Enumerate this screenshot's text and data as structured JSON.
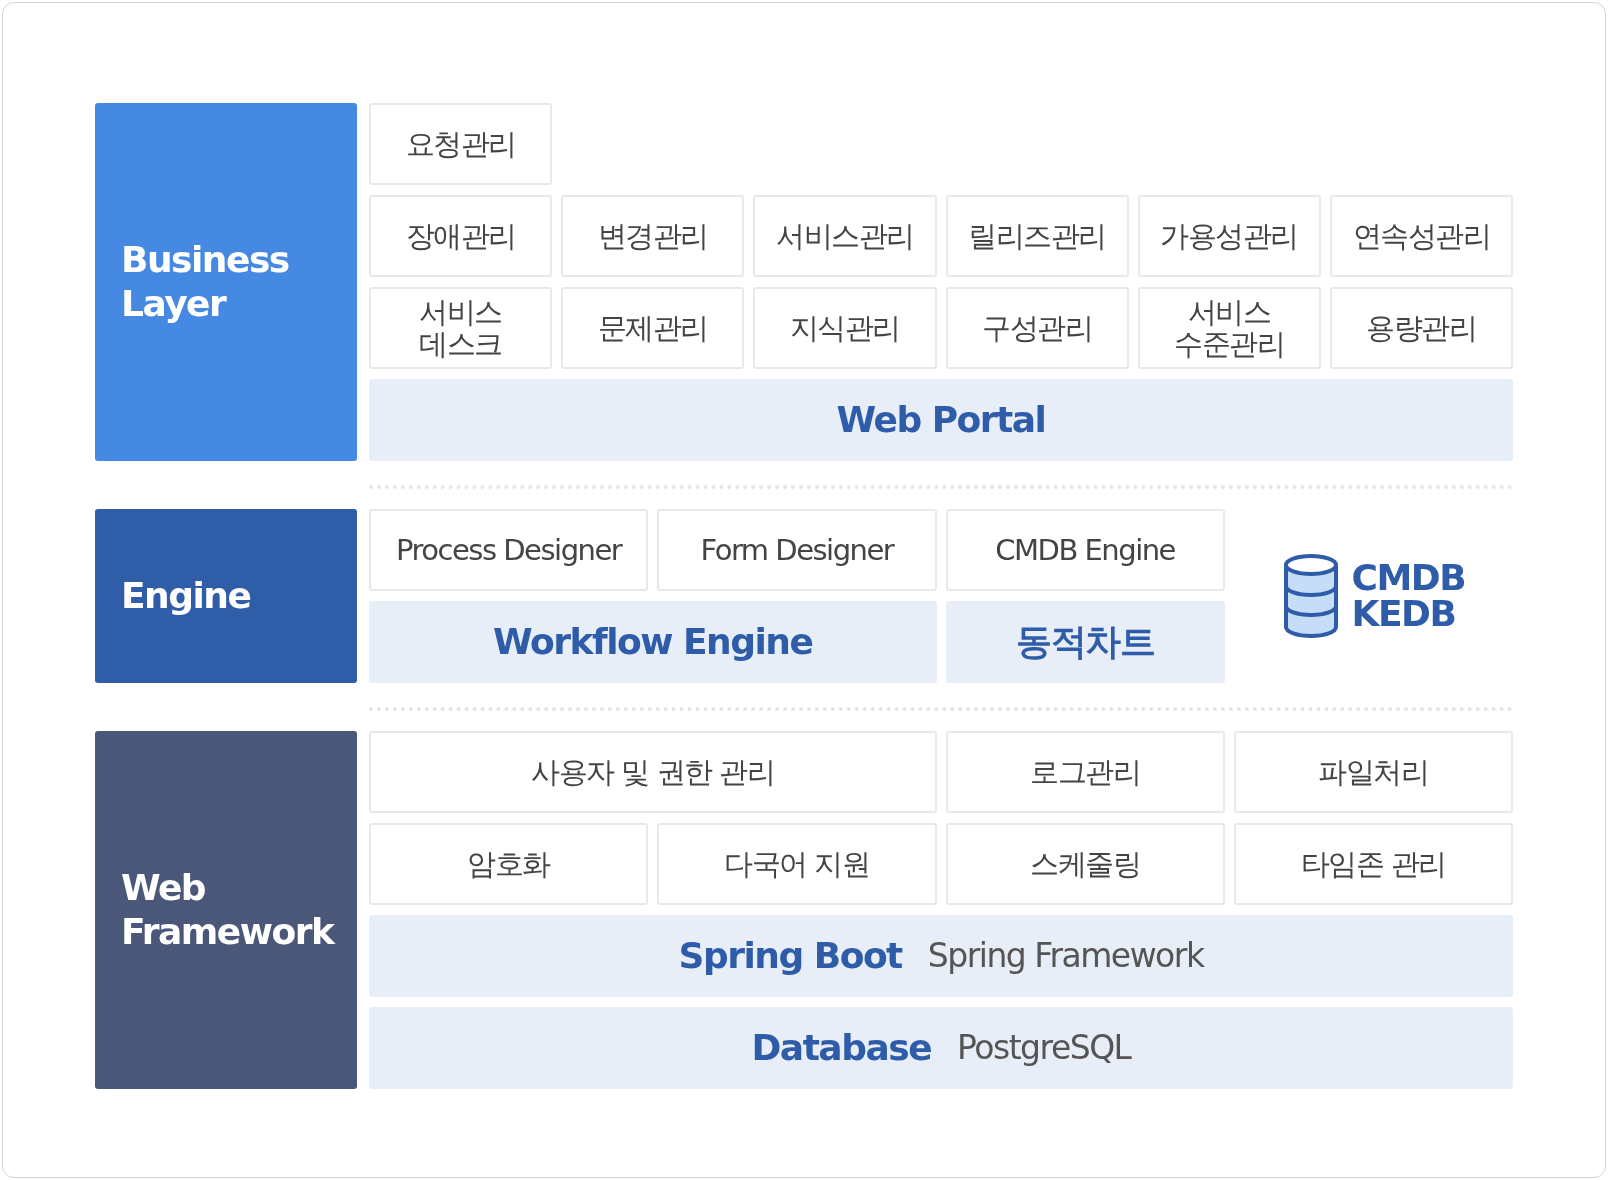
{
  "sections": [
    {
      "kind": "business",
      "title": "Business Layer",
      "color": "#4689e3",
      "rows": [
        [
          {
            "kind": "box",
            "text": "요청관리"
          }
        ],
        [
          {
            "kind": "box",
            "text": "장애관리"
          },
          {
            "kind": "box",
            "text": "변경관리"
          },
          {
            "kind": "box",
            "text": "서비스관리"
          },
          {
            "kind": "box",
            "text": "릴리즈관리"
          },
          {
            "kind": "box",
            "text": "가용성관리"
          },
          {
            "kind": "box",
            "text": "연속성관리"
          }
        ],
        [
          {
            "kind": "box",
            "text": "서비스\n데스크"
          },
          {
            "kind": "box",
            "text": "문제관리"
          },
          {
            "kind": "box",
            "text": "지식관리"
          },
          {
            "kind": "box",
            "text": "구성관리"
          },
          {
            "kind": "box",
            "text": "서비스\n수준관리"
          },
          {
            "kind": "box",
            "text": "용량관리"
          }
        ],
        [
          {
            "kind": "banner",
            "text": "Web Portal"
          }
        ]
      ]
    },
    {
      "kind": "engine",
      "title": "Engine",
      "color": "#2f5da8",
      "store": [
        "CMDB",
        "KEDB"
      ],
      "rows": [
        [
          {
            "kind": "box",
            "text": "Process Designer"
          },
          {
            "kind": "box",
            "text": "Form Designer"
          },
          {
            "kind": "box",
            "text": "CMDB Engine"
          }
        ],
        [
          {
            "kind": "bar",
            "text": "Workflow Engine",
            "colspan": 2
          },
          {
            "kind": "bar",
            "text": "동적차트"
          }
        ]
      ]
    },
    {
      "kind": "framework",
      "title": "Web\nFramework",
      "color": "#4a5779",
      "rows": [
        [
          {
            "kind": "box",
            "text": "사용자 및 권한 관리",
            "colspan": 2
          },
          {
            "kind": "box",
            "text": "로그관리"
          },
          {
            "kind": "box",
            "text": "파일처리"
          }
        ],
        [
          {
            "kind": "box",
            "text": "암호화"
          },
          {
            "kind": "box",
            "text": "다국어 지원"
          },
          {
            "kind": "box",
            "text": "스케줄링"
          },
          {
            "kind": "box",
            "text": "타임존 관리"
          }
        ],
        [
          {
            "kind": "banner",
            "text": "Spring Boot",
            "detail": "Spring Framework"
          }
        ],
        [
          {
            "kind": "banner",
            "text": "Database",
            "detail": "PostgreSQL"
          }
        ]
      ]
    }
  ]
}
